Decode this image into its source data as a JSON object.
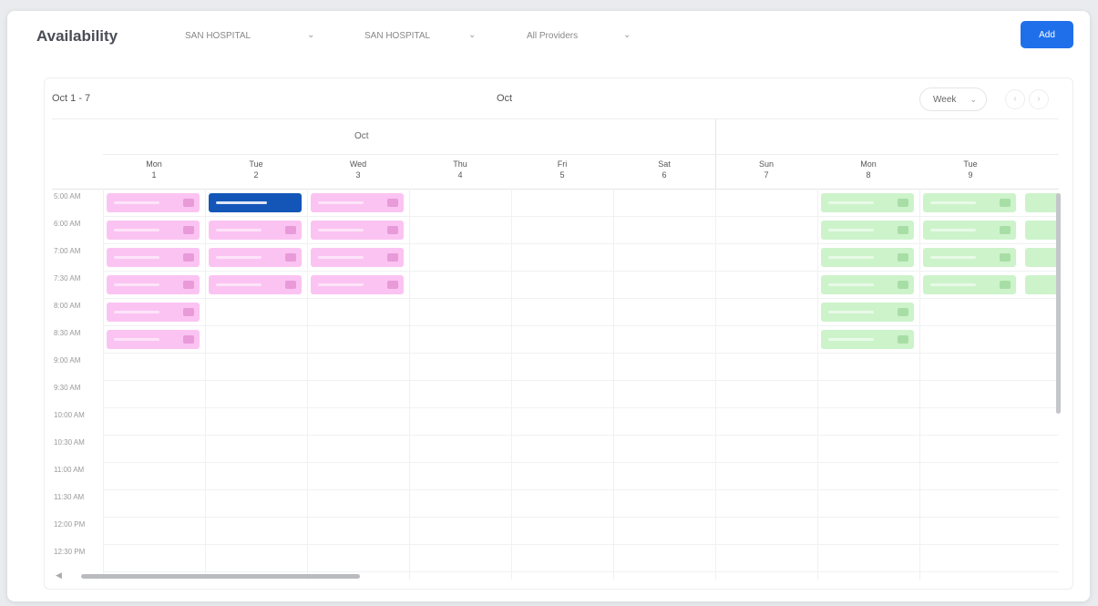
{
  "header": {
    "title": "Availability",
    "filters": [
      {
        "value": "SAN HOSPITAL"
      },
      {
        "value": "SAN HOSPITAL"
      },
      {
        "value": "All Providers"
      }
    ],
    "add_label": "Add"
  },
  "calendar": {
    "range": "Oct 1 - 7",
    "center_label": "Oct",
    "view": "Week",
    "groups": [
      "Oct",
      ""
    ],
    "days": [
      {
        "name": "Mon",
        "date": "1"
      },
      {
        "name": "Tue",
        "date": "2"
      },
      {
        "name": "Wed",
        "date": "3"
      },
      {
        "name": "Thu",
        "date": "4"
      },
      {
        "name": "Fri",
        "date": "5"
      },
      {
        "name": "Sat",
        "date": "6"
      },
      {
        "name": "Sun",
        "date": "7"
      },
      {
        "name": "Mon",
        "date": "8"
      },
      {
        "name": "Tue",
        "date": "9"
      }
    ],
    "times": [
      "5:00 AM",
      "6:00 AM",
      "7:00 AM",
      "7:30 AM",
      "8:00 AM",
      "8:30 AM",
      "9:00 AM",
      "9:30 AM",
      "10:00 AM",
      "10:30 AM",
      "11:00 AM",
      "11:30 AM",
      "12:00 PM",
      "12:30 PM"
    ],
    "colors": {
      "pink": "#fbc3f2",
      "green": "#cdf3cb",
      "blue": "#1456b8",
      "accent": "#1f6feb"
    }
  }
}
